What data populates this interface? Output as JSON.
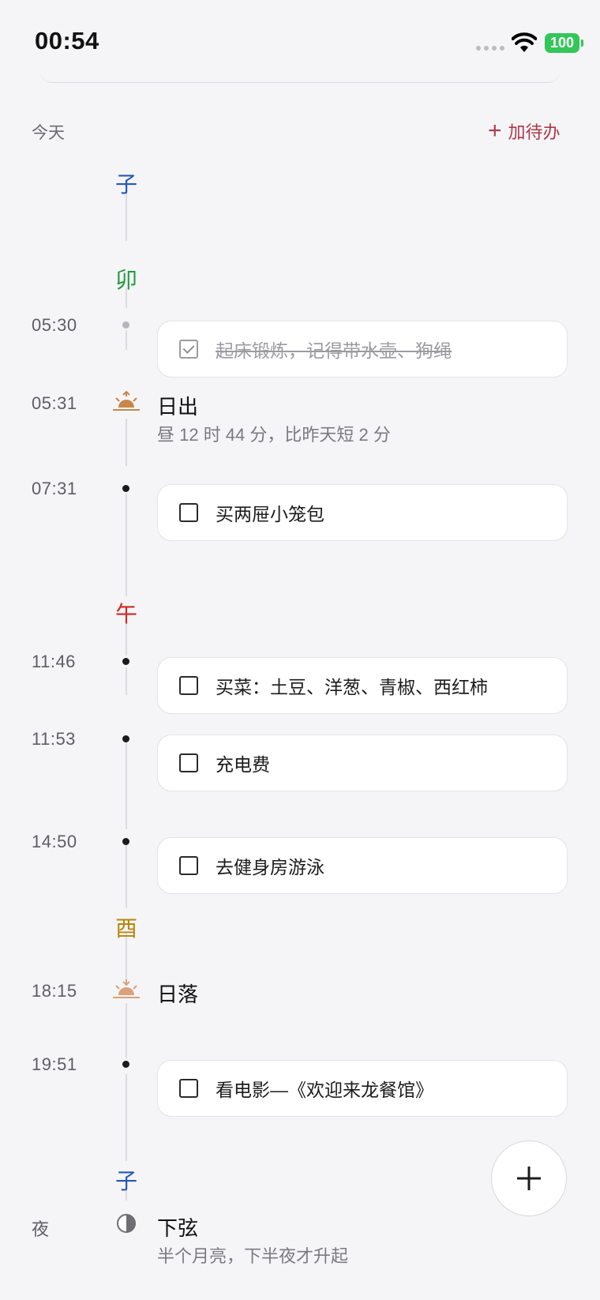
{
  "status_bar": {
    "time": "00:54",
    "battery": "100"
  },
  "header": {
    "section_label": "今天",
    "add_todo_label": "加待办",
    "add_icon": "plus"
  },
  "shichen": {
    "zi": "子",
    "mao": "卯",
    "wu": "午",
    "you": "酉",
    "zi_night": "子"
  },
  "colors": {
    "zi": "#2458b5",
    "mao": "#1f9a3d",
    "wu": "#cc2a22",
    "you": "#b8860b",
    "accent": "#b0384a",
    "sun": "#c7864a"
  },
  "todos": [
    {
      "time": "05:30",
      "text": "起床锻炼，记得带水壶、狗绳",
      "done": true
    },
    {
      "time": "07:31",
      "text": "买两屉小笼包",
      "done": false
    },
    {
      "time": "11:46",
      "text": "买菜：土豆、洋葱、青椒、西红柿",
      "done": false
    },
    {
      "time": "11:53",
      "text": "充电费",
      "done": false
    },
    {
      "time": "14:50",
      "text": "去健身房游泳",
      "done": false
    },
    {
      "time": "19:51",
      "text": "看电影—《欢迎来龙餐馆》",
      "done": false
    }
  ],
  "sunrise": {
    "time": "05:31",
    "title": "日出",
    "subtitle": "昼 12 时 44 分，比昨天短 2 分",
    "icon": "sunrise-icon"
  },
  "sunset": {
    "time": "18:15",
    "title": "日落",
    "icon": "sunset-icon"
  },
  "moon": {
    "time": "夜",
    "title": "下弦",
    "subtitle": "半个月亮，下半夜才升起",
    "icon": "half-moon-icon"
  },
  "fab": {
    "icon": "plus"
  }
}
